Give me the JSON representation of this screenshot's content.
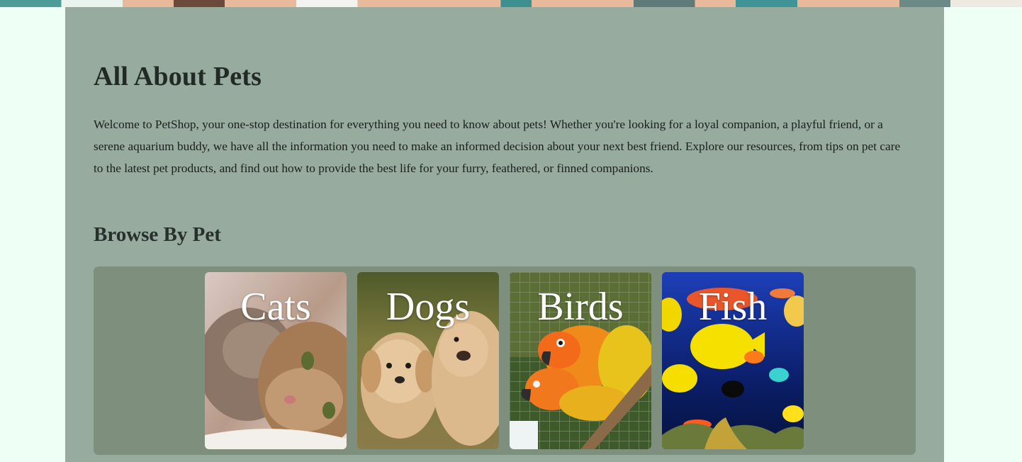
{
  "page": {
    "title": "All About Pets",
    "intro": "Welcome to PetShop, your one-stop destination for everything you need to know about pets! Whether you're looking for a loyal companion, a playful friend, or a serene aquarium buddy, we have all the information you need to make an informed decision about your next best friend. Explore our resources, from tips on pet care to the latest pet products, and find out how to provide the best life for your furry, feathered, or finned companions.",
    "browse_heading": "Browse By Pet"
  },
  "pets": [
    {
      "label": "Cats",
      "image": "kittens-photo"
    },
    {
      "label": "Dogs",
      "image": "puppies-photo"
    },
    {
      "label": "Birds",
      "image": "parrots-photo"
    },
    {
      "label": "Fish",
      "image": "tropical-fish-photo"
    }
  ],
  "colors": {
    "page_background": "#eefff5",
    "container": "#97ab9f",
    "strip": "#7e8f7e",
    "heading": "#222a26"
  }
}
